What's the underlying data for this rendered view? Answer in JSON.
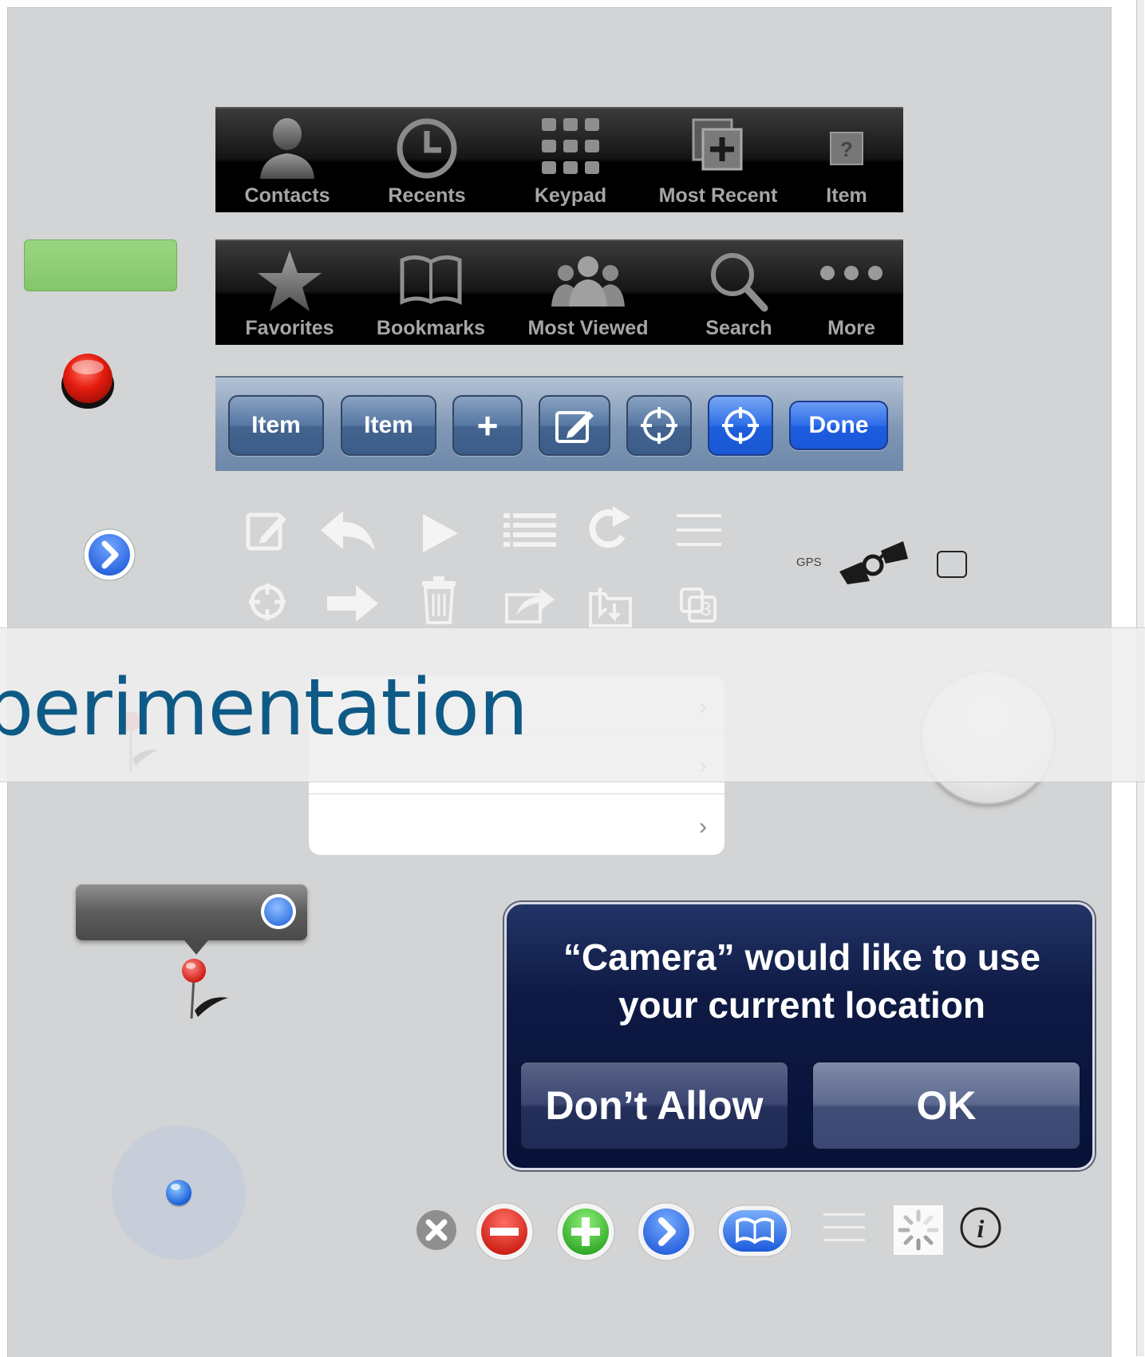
{
  "tabbar1": {
    "items": [
      {
        "label": "Contacts",
        "icon": "contact-person-icon"
      },
      {
        "label": "Recents",
        "icon": "clock-icon"
      },
      {
        "label": "Keypad",
        "icon": "keypad-grid-icon"
      },
      {
        "label": "Most Recent",
        "icon": "most-recent-icon"
      },
      {
        "label": "Item",
        "icon": "unknown-item-icon"
      }
    ]
  },
  "tabbar2": {
    "items": [
      {
        "label": "Favorites",
        "icon": "star-icon"
      },
      {
        "label": "Bookmarks",
        "icon": "book-icon"
      },
      {
        "label": "Most Viewed",
        "icon": "group-icon"
      },
      {
        "label": "Search",
        "icon": "magnifier-icon"
      },
      {
        "label": "More",
        "icon": "ellipsis-icon"
      }
    ]
  },
  "toolbar": {
    "item1": "Item",
    "item2": "Item",
    "add": "+",
    "done": "Done"
  },
  "gps": {
    "label": "GPS"
  },
  "overlay": {
    "title": "perimentation"
  },
  "badge": {
    "count": "3"
  },
  "alert": {
    "title": "“Camera” would like to use your current location",
    "cancel": "Don’t Allow",
    "ok": "OK"
  },
  "colors": {
    "canvas": "#d3d4d5",
    "green_button": "#8fcc75",
    "toolbar_blue": "#7f97b5",
    "done_blue": "#2d6de8",
    "alert_navy": "#0e1a44",
    "overlay_text": "#0e5a86"
  }
}
